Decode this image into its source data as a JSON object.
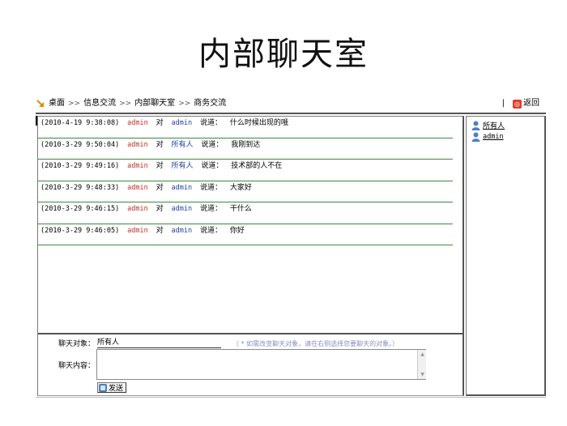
{
  "page": {
    "title": "内部聊天室"
  },
  "breadcrumb": {
    "items": [
      "桌面",
      "信息交流",
      "内部聊天室",
      "商务交流"
    ],
    "separator": ">>",
    "back_label": "返回"
  },
  "messages": [
    {
      "time": "(2010-4-19 9:38:08)",
      "from": "admin",
      "verb": "对",
      "to": "admin",
      "said": "说道：",
      "text": "什么时候出现的哦"
    },
    {
      "time": "(2010-3-29 9:50:04)",
      "from": "admin",
      "verb": "对",
      "to": "所有人",
      "said": "说道：",
      "text": "我刚到达"
    },
    {
      "time": "(2010-3-29 9:49:16)",
      "from": "admin",
      "verb": "对",
      "to": "所有人",
      "said": "说道：",
      "text": "技术部的人不在"
    },
    {
      "time": "(2010-3-29 9:48:33)",
      "from": "admin",
      "verb": "对",
      "to": "admin",
      "said": "说道：",
      "text": "大家好"
    },
    {
      "time": "(2010-3-29 9:46:15)",
      "from": "admin",
      "verb": "对",
      "to": "admin",
      "said": "说道：",
      "text": "干什么"
    },
    {
      "time": "(2010-3-29 9:46:05)",
      "from": "admin",
      "verb": "对",
      "to": "admin",
      "said": "说道：",
      "text": "你好"
    }
  ],
  "compose": {
    "target_label": "聊天对象：",
    "target_value": "所有人",
    "target_hint": "（ * 如需改变聊天对象，请在右侧选择您要聊天的对象。）",
    "content_label": "聊天内容：",
    "content_value": "",
    "send_label": "发送"
  },
  "users": [
    {
      "name": "所有人",
      "icon": "user-icon"
    },
    {
      "name": "admin",
      "icon": "user-icon"
    }
  ],
  "colors": {
    "sender": "#c0302a",
    "recipient": "#2442a8",
    "divider": "#3a8a3a",
    "hint": "#8a8fc0",
    "back_icon": "#e23b2a"
  }
}
